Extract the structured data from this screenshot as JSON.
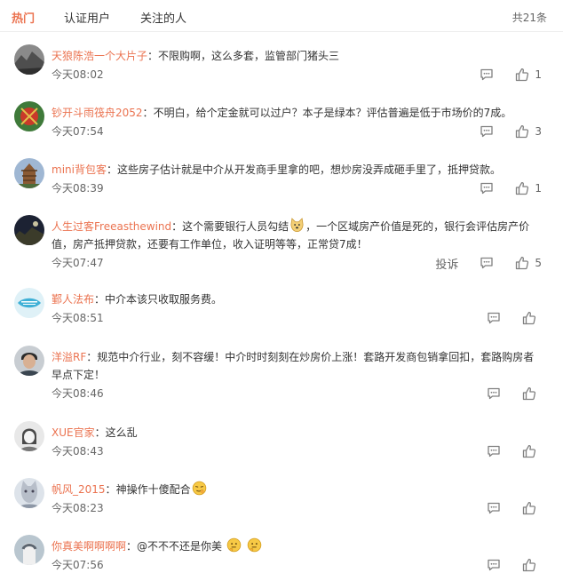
{
  "tabs": [
    {
      "label": "热门",
      "active": true
    },
    {
      "label": "认证用户",
      "active": false
    },
    {
      "label": "关注的人",
      "active": false
    }
  ],
  "total": "共21条",
  "colors": {
    "accent": "#eb7350",
    "text": "#333333",
    "muted": "#666666"
  },
  "comments": [
    {
      "user": "天狼陈浩一个大片子",
      "sep": "：",
      "body": "不限购啊，这么多套，监管部门猪头三",
      "time": "今天08:02",
      "likes": "1"
    },
    {
      "user": "钞开斗雨筏舟2052",
      "sep": "：",
      "body": "不明白，给个定金就可以过户？本子是绿本？评估普遍是低于市场价的7成。",
      "time": "今天07:54",
      "likes": "3"
    },
    {
      "user": "mini背包客",
      "sep": "：",
      "body": "这些房子估计就是中介从开发商手里拿的吧，想炒房没弄成砸手里了，抵押贷款。",
      "time": "今天08:39",
      "likes": "1"
    },
    {
      "user": "人生过客Freeasthewind",
      "sep": "：",
      "body_before": "这个需要银行人员勾结",
      "body_after": "，一个区域房产价值是死的，银行会评估房产价",
      "body_line2": "值，房产抵押贷款，还要有工作单位，收入证明等等，正常贷7成！",
      "time": "今天07:47",
      "likes": "5",
      "report": "投诉"
    },
    {
      "user": "鄞人法布",
      "sep": "：",
      "body": "中介本该只收取服务费。",
      "time": "今天08:51",
      "likes": ""
    },
    {
      "user": "洋溢RF",
      "sep": "：",
      "body": "规范中介行业，刻不容缓！中介时时刻刻在炒房价上涨！套路开发商包销拿回扣，套路购房者",
      "body_line2": "早点下定！",
      "time": "今天08:46",
      "likes": ""
    },
    {
      "user": "XUE官家",
      "sep": "：",
      "body": "这么乱",
      "time": "今天08:43",
      "likes": ""
    },
    {
      "user": "帆风_2015",
      "sep": "：",
      "body": "神操作十傻配合",
      "time": "今天08:23",
      "likes": ""
    },
    {
      "user": "你真美啊啊啊啊",
      "sep": "：",
      "body": "@不不不还是你美",
      "time": "今天07:56",
      "likes": ""
    }
  ],
  "icons": {
    "reply": "comment-icon",
    "like": "thumbs-up-icon"
  }
}
